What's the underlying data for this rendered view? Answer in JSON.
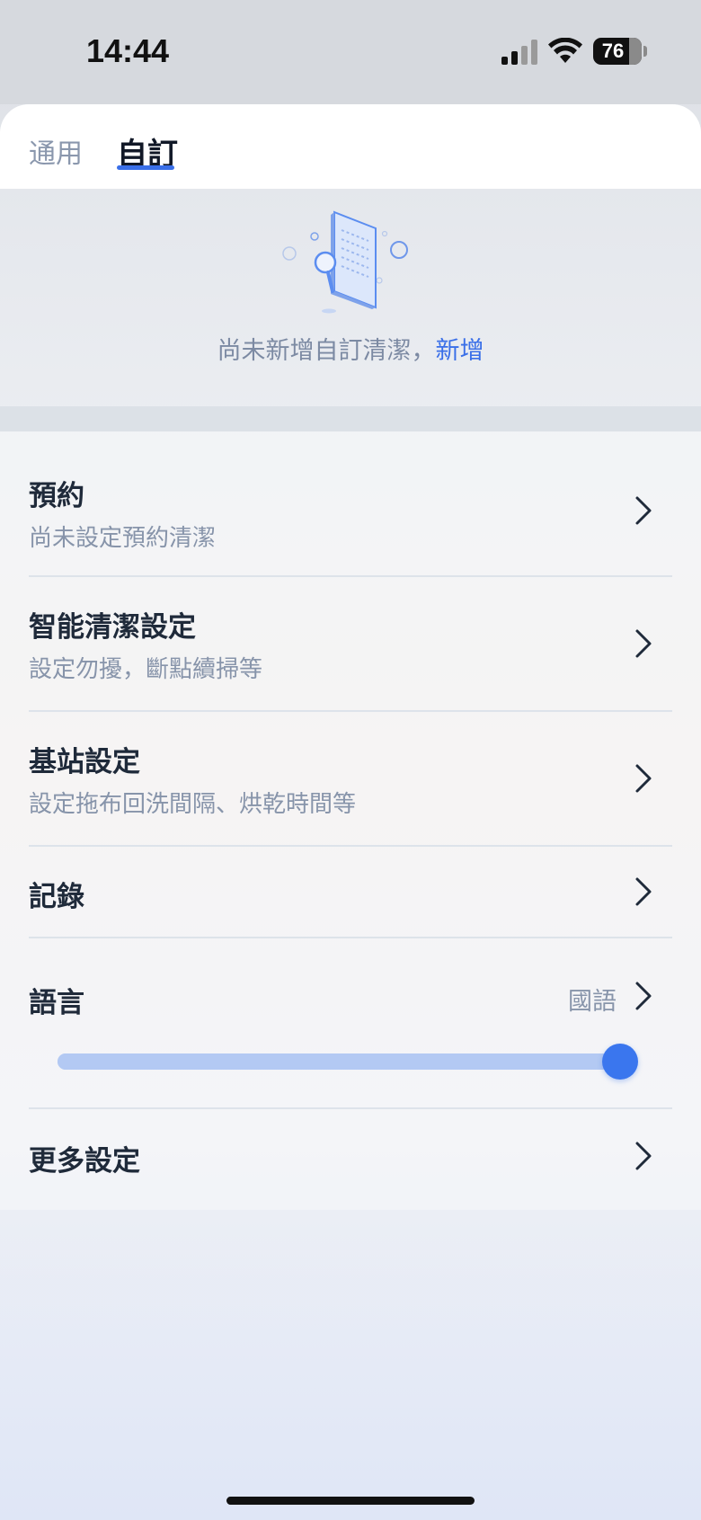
{
  "status_bar": {
    "time": "14:44",
    "battery": "76"
  },
  "tabs": [
    {
      "label": "通用",
      "selected": false
    },
    {
      "label": "自訂",
      "selected": true
    }
  ],
  "empty_state": {
    "message": "尚未新增自訂清潔，",
    "action": "新增"
  },
  "settings": {
    "schedule": {
      "title": "預約",
      "subtitle": "尚未設定預約清潔"
    },
    "smart_clean": {
      "title": "智能清潔設定",
      "subtitle": "設定勿擾，斷點續掃等"
    },
    "base_station": {
      "title": "基站設定",
      "subtitle": "設定拖布回洗間隔、烘乾時間等"
    },
    "records": {
      "title": "記錄"
    },
    "language": {
      "title": "語言",
      "value": "國語",
      "volume_level": 1.0
    },
    "more": {
      "title": "更多設定"
    }
  },
  "colors": {
    "accent": "#3a6fe8",
    "slider_track": "#b3c9f3",
    "subtitle": "#8794aa"
  }
}
